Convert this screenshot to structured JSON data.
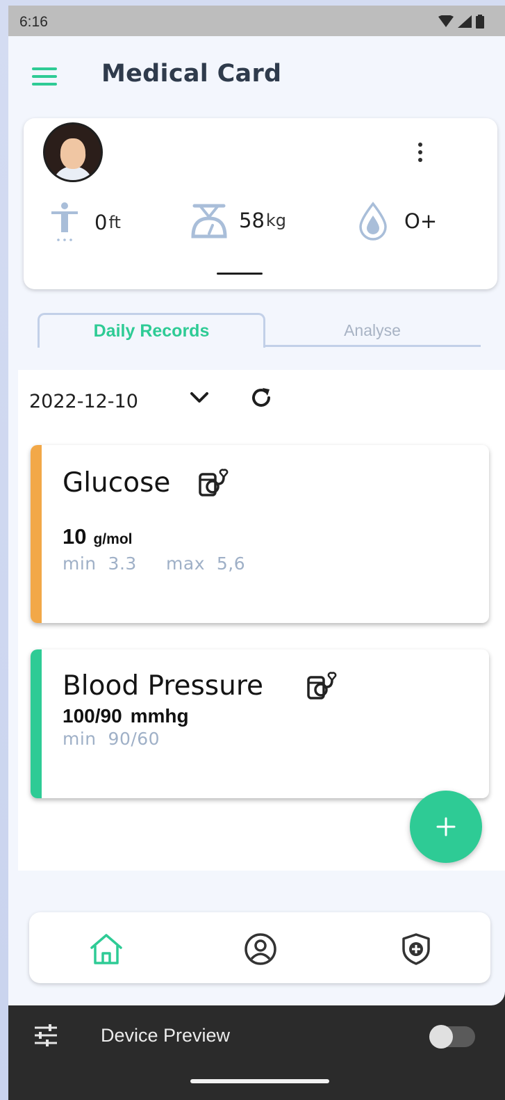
{
  "status_bar": {
    "time": "6:16"
  },
  "app_bar": {
    "title": "Medical Card",
    "menu_icon": "hamburger-menu-icon"
  },
  "profile": {
    "avatar_icon": "avatar-photo",
    "more_icon": "more-vertical-icon",
    "height": {
      "value": "0",
      "unit": "ft",
      "icon": "height-person-icon"
    },
    "weight": {
      "value": "58",
      "unit": "kg",
      "icon": "weight-scale-icon"
    },
    "blood": {
      "value": "O+",
      "icon": "blood-drop-icon"
    }
  },
  "tabs": [
    {
      "label": "Daily Records",
      "active": true
    },
    {
      "label": "Analyse",
      "active": false
    }
  ],
  "date_filter": {
    "date": "2022-12-10",
    "dropdown_icon": "chevron-down-icon",
    "refresh_icon": "refresh-icon"
  },
  "records": [
    {
      "title": "Glucose",
      "value": "10",
      "unit": "g/mol",
      "range": "min  3.3     max  5,6",
      "accent": "#f2a848",
      "icon": "medical-device-icon"
    },
    {
      "title": "Blood Pressure",
      "value": "100/90",
      "unit": "mmhg",
      "range": "min  90/60",
      "accent": "#2ecb95",
      "icon": "medical-device-icon"
    }
  ],
  "fab": {
    "icon": "plus-icon"
  },
  "bottom_nav": [
    {
      "icon": "home-icon",
      "active": true
    },
    {
      "icon": "profile-icon",
      "active": false
    },
    {
      "icon": "shield-plus-icon",
      "active": false
    }
  ],
  "device_preview": {
    "label": "Device Preview",
    "toggle_on": false
  },
  "colors": {
    "accent": "#2ecb95",
    "title": "#2f3b4c",
    "muted": "#9fb0c7"
  }
}
